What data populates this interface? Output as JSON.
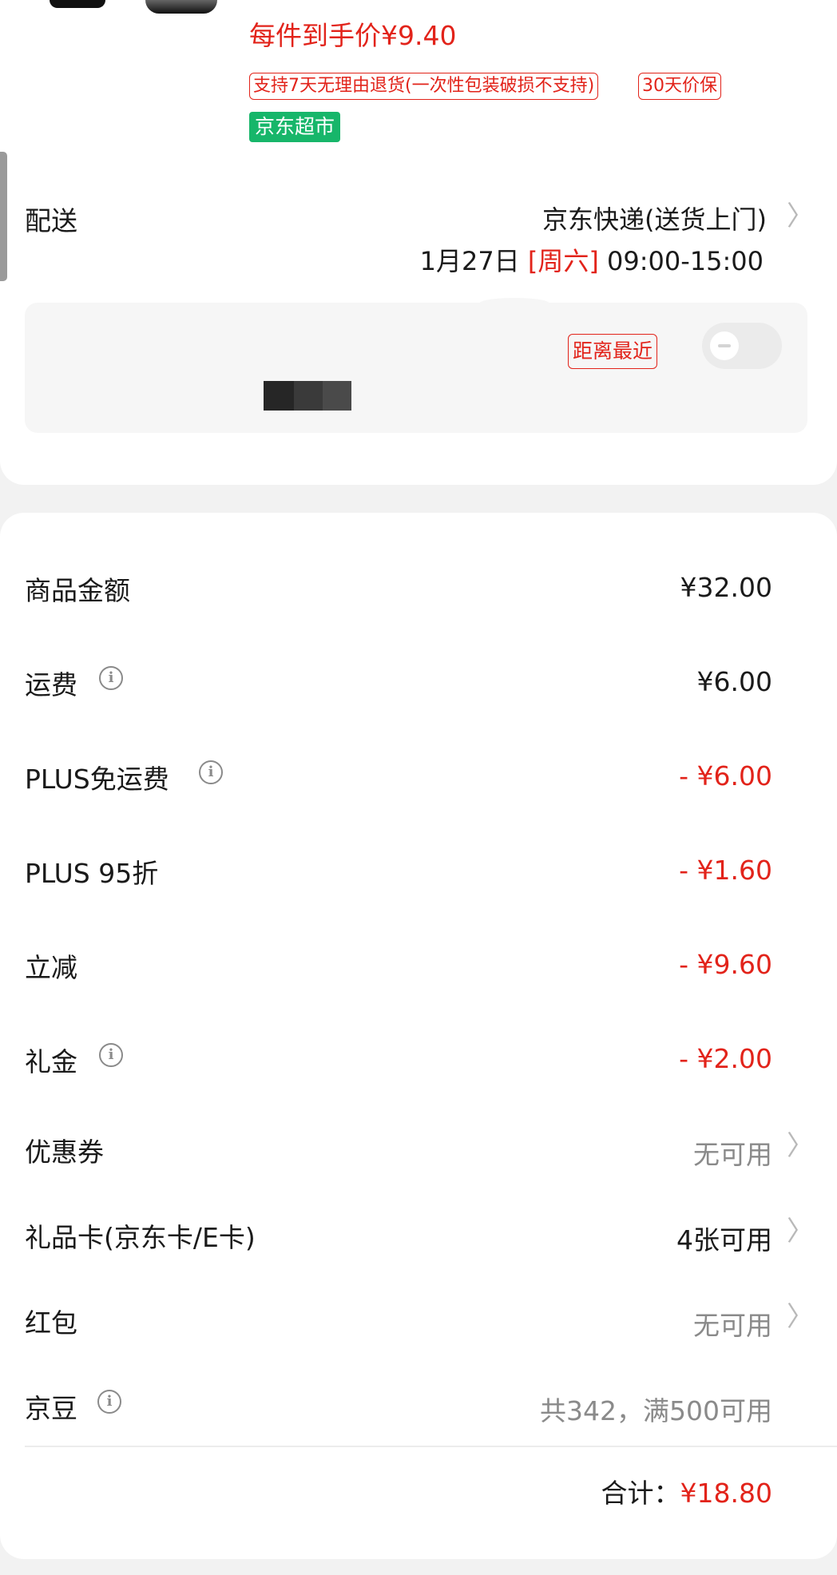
{
  "product": {
    "unit_price": "每件到手价¥9.40",
    "tags": {
      "return_policy": "支持7天无理由退货(一次性包装破损不支持)",
      "price_protect": "30天价保",
      "store_badge": "京东超市"
    }
  },
  "delivery": {
    "label": "配送",
    "method": "京东快递(送货上门)",
    "date": "1月27日",
    "weekday": "[周六]",
    "time_range": "09:00-15:00",
    "pickup": {
      "nearest_tag": "距离最近",
      "toggle_on": false
    }
  },
  "summary": {
    "rows": [
      {
        "label": "商品金额",
        "value": "¥32.00",
        "info": false,
        "style": "normal"
      },
      {
        "label": "运费",
        "value": "¥6.00",
        "info": true,
        "style": "normal"
      },
      {
        "label": "PLUS免运费",
        "value": "- ¥6.00",
        "info": true,
        "style": "red"
      },
      {
        "label": "PLUS 95折",
        "value": "- ¥1.60",
        "info": false,
        "style": "red"
      },
      {
        "label": "立减",
        "value": "- ¥9.60",
        "info": false,
        "style": "red"
      },
      {
        "label": "礼金",
        "value": "- ¥2.00",
        "info": true,
        "style": "red"
      },
      {
        "label": "优惠券",
        "value": "无可用",
        "info": false,
        "style": "grey",
        "chevron": true
      },
      {
        "label": "礼品卡(京东卡/E卡)",
        "value": "4张可用",
        "info": false,
        "style": "normal",
        "chevron": true
      },
      {
        "label": "红包",
        "value": "无可用",
        "info": false,
        "style": "grey",
        "chevron": true
      },
      {
        "label": "京豆",
        "value": "共342，满500可用",
        "info": true,
        "style": "grey"
      }
    ],
    "total_label": "合计：",
    "total_value": "¥18.80"
  },
  "colors": {
    "accent_red": "#e2231a",
    "supermarket_green": "#17b66a",
    "page_bg": "#f2f2f2"
  },
  "icons": {
    "info": "info-circle-icon",
    "chevron": "chevron-right-icon"
  }
}
